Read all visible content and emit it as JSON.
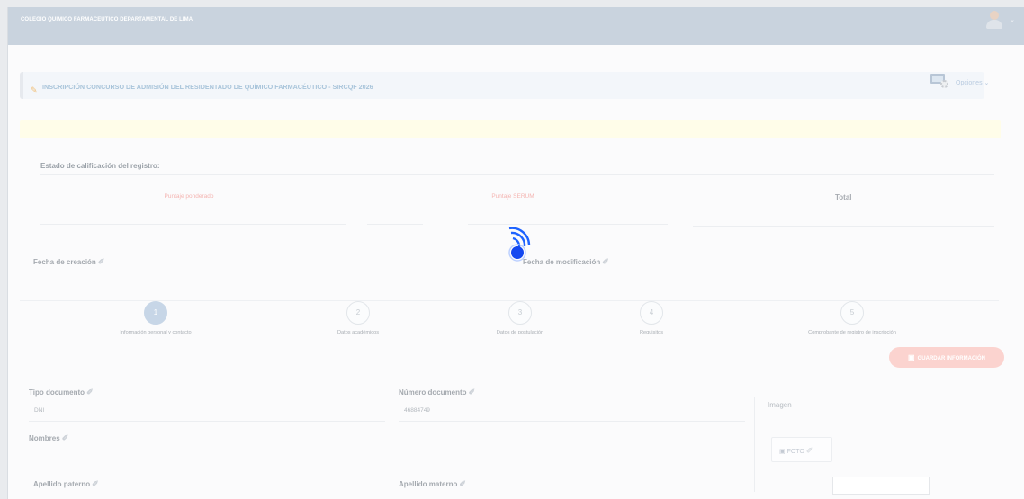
{
  "header": {
    "brand": "COLEGIO QUIMICO FARMACEUTICO DEPARTAMENTAL DE LIMA"
  },
  "page": {
    "title": "INSCRIPCIÓN CONCURSO DE ADMISIÓN DEL RESIDENTADO DE QUÍMICO FARMACÉUTICO - SIRCQF 2026",
    "options_label": "Opciones ⌄"
  },
  "rating": {
    "title": "Estado de calificación del registro:",
    "weighted_score_label": "Puntaje ponderado",
    "serum_score_label": "Puntaje SERUM",
    "total_label": "Total"
  },
  "dates": {
    "created_label": "Fecha de creación",
    "modified_label": "Fecha de modificación"
  },
  "steps": [
    {
      "number": "1",
      "label": "Información personal y contacto"
    },
    {
      "number": "2",
      "label": "Datos académicos"
    },
    {
      "number": "3",
      "label": "Datos de postulación"
    },
    {
      "number": "4",
      "label": "Requisitos"
    },
    {
      "number": "5",
      "label": "Comprobante de registro de inscripción"
    }
  ],
  "form": {
    "save_label": "GUARDAR INFORMACIÓN",
    "doc_type_label": "Tipo documento",
    "doc_type_value": "DNI",
    "doc_number_label": "Número documento",
    "doc_number_value": "46884749",
    "names_label": "Nombres",
    "paternal_label": "Apellido paterno",
    "maternal_label": "Apellido materno",
    "image_label": "Imagen",
    "photo_label": "FOTO"
  },
  "colors": {
    "accent": "#1a5cff",
    "save_button": "#fbd3cf",
    "step_active": "#c7d6e7"
  }
}
